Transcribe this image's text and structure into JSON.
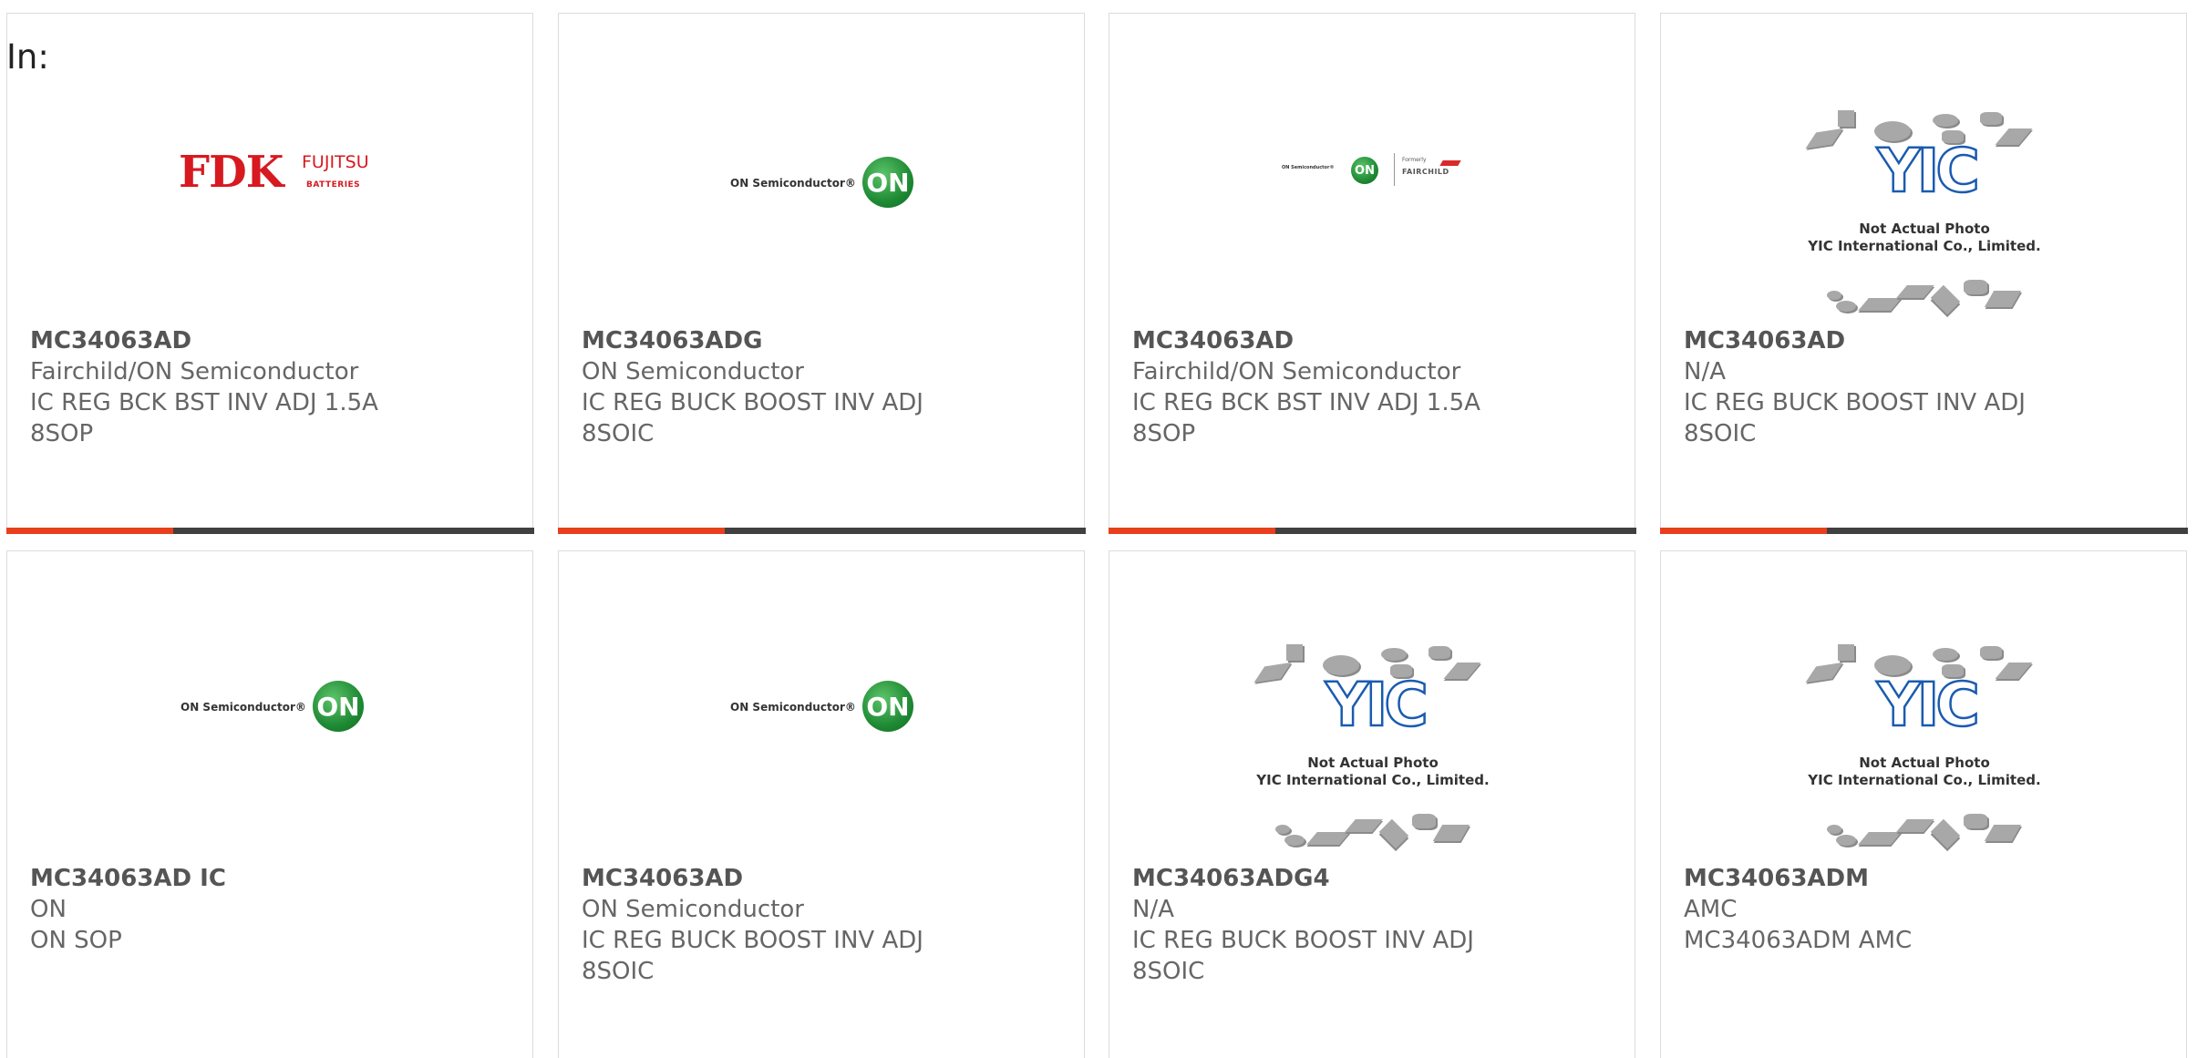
{
  "header": {
    "label": "In:"
  },
  "colors": {
    "accent": "#e8401c",
    "bar": "#404040",
    "text": "#666666"
  },
  "products": [
    {
      "part": "MC34063AD",
      "manufacturer": "Fairchild/ON Semiconductor",
      "desc": "IC REG BCK BST INV ADJ 1.5A",
      "package": "8SOP",
      "logo": "fdk-fujitsu-logo",
      "logo_text": {
        "main": "FDK",
        "brand": "FUJITSU",
        "sub": "BATTERIES"
      }
    },
    {
      "part": "MC34063ADG",
      "manufacturer": "ON Semiconductor",
      "desc": "IC REG BUCK BOOST INV ADJ",
      "package": "8SOIC",
      "logo": "on-semiconductor-logo",
      "logo_text": {
        "name": "ON Semiconductor®",
        "badge": "ON"
      }
    },
    {
      "part": "MC34063AD",
      "manufacturer": "Fairchild/ON Semiconductor",
      "desc": "IC REG BCK BST INV ADJ 1.5A",
      "package": "8SOP",
      "logo": "on-fairchild-logo",
      "logo_text": {
        "name": "ON Semiconductor®",
        "badge": "ON",
        "formerly": "Formerly",
        "brand": "FAIRCHILD"
      }
    },
    {
      "part": "MC34063AD",
      "manufacturer": "N/A",
      "desc": "IC REG BUCK BOOST INV ADJ",
      "package": "8SOIC",
      "logo": "yic-placeholder",
      "logo_text": {
        "mark": "YIC",
        "line1": "Not Actual Photo",
        "line2": "YIC International Co., Limited."
      }
    },
    {
      "part": "MC34063AD IC",
      "manufacturer": "ON",
      "desc": "ON SOP",
      "package": "",
      "logo": "on-semiconductor-logo",
      "logo_text": {
        "name": "ON Semiconductor®",
        "badge": "ON"
      }
    },
    {
      "part": "MC34063AD",
      "manufacturer": "ON Semiconductor",
      "desc": "IC REG BUCK BOOST INV ADJ",
      "package": "8SOIC",
      "logo": "on-semiconductor-logo",
      "logo_text": {
        "name": "ON Semiconductor®",
        "badge": "ON"
      }
    },
    {
      "part": "MC34063ADG4",
      "manufacturer": "N/A",
      "desc": "IC REG BUCK BOOST INV ADJ",
      "package": "8SOIC",
      "logo": "yic-placeholder",
      "logo_text": {
        "mark": "YIC",
        "line1": "Not Actual Photo",
        "line2": "YIC International Co., Limited."
      }
    },
    {
      "part": "MC34063ADM",
      "manufacturer": "AMC",
      "desc": "MC34063ADM AMC",
      "package": "",
      "logo": "yic-placeholder",
      "logo_text": {
        "mark": "YIC",
        "line1": "Not Actual Photo",
        "line2": "YIC International Co., Limited."
      }
    }
  ]
}
